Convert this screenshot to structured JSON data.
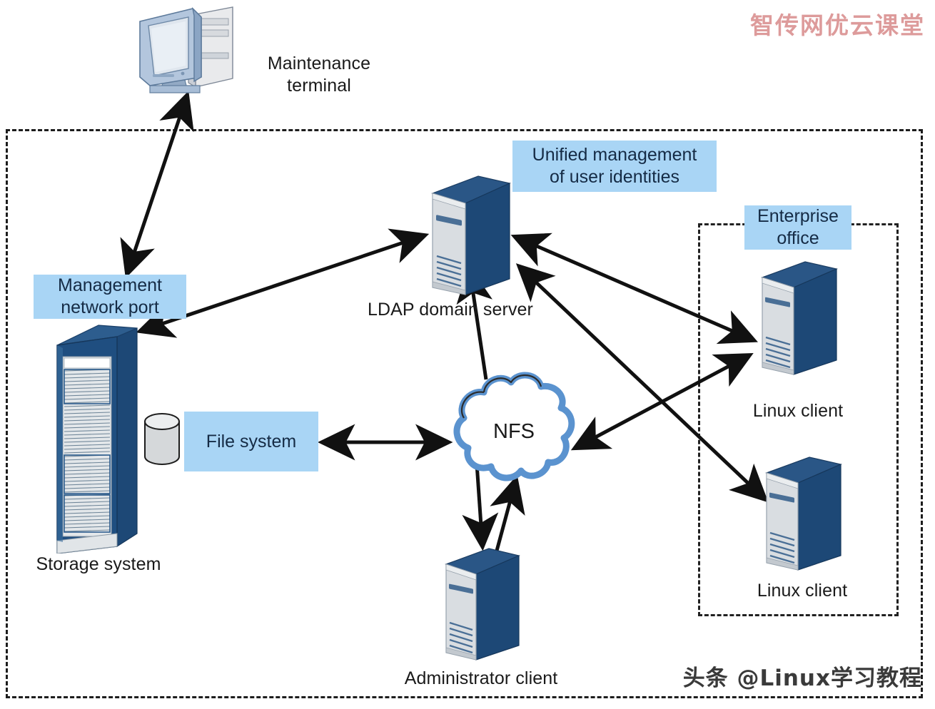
{
  "diagram": {
    "title": "LDAP unified identity with NFS storage architecture",
    "colors": {
      "callout_fill": "#a9d5f5",
      "callout_text": "#152b45",
      "label_text": "#1a1a1a",
      "arrow": "#111111",
      "dashed_border": "#1d1d1d",
      "server_dark": "#1f4a77",
      "server_light": "#dfe4e8",
      "cloud_outline": "#5b93cf",
      "watermark_top": "#d98e8e",
      "watermark_bottom": "#3a3a3a"
    }
  },
  "watermarks": {
    "top_right": "智传网优云课堂",
    "bottom_right": "头条 @Linux学习教程"
  },
  "callouts": [
    {
      "id": "unified-management",
      "text": "Unified management\nof user identities"
    },
    {
      "id": "management-network-port",
      "text": "Management\nnetwork port"
    },
    {
      "id": "enterprise-office",
      "text": "Enterprise\noffice"
    },
    {
      "id": "file-system",
      "text": "File system"
    }
  ],
  "nodes": [
    {
      "id": "maintenance-terminal",
      "label": "Maintenance\nterminal",
      "icon": "crt-workstation-icon"
    },
    {
      "id": "storage-system",
      "label": "Storage system",
      "icon": "storage-rack-icon"
    },
    {
      "id": "disk",
      "label": "",
      "icon": "database-cylinder-icon"
    },
    {
      "id": "ldap-domain-server",
      "label": "LDAP domain server",
      "icon": "server-tower-icon"
    },
    {
      "id": "nfs-cloud",
      "label": "NFS",
      "icon": "cloud-icon"
    },
    {
      "id": "administrator-client",
      "label": "Administrator client",
      "icon": "server-tower-icon"
    },
    {
      "id": "linux-client-1",
      "label": "Linux client",
      "icon": "server-tower-icon"
    },
    {
      "id": "linux-client-2",
      "label": "Linux client",
      "icon": "server-tower-icon"
    }
  ],
  "containers": [
    {
      "id": "datacenter-boundary",
      "style": "dashed"
    },
    {
      "id": "enterprise-office-boundary",
      "style": "dashed"
    }
  ],
  "connections": [
    {
      "id": "terminal-to-management-port",
      "from": "maintenance-terminal",
      "to": "management-network-port",
      "arrow": "double"
    },
    {
      "id": "storage-to-ldap",
      "from": "storage-system",
      "to": "ldap-domain-server",
      "arrow": "double"
    },
    {
      "id": "filesystem-to-nfs",
      "from": "file-system",
      "to": "nfs-cloud",
      "arrow": "double"
    },
    {
      "id": "nfs-to-ldap",
      "from": "nfs-cloud",
      "to": "ldap-domain-server",
      "arrow": "single"
    },
    {
      "id": "nfs-to-admin-down",
      "from": "nfs-cloud",
      "to": "administrator-client",
      "arrow": "single"
    },
    {
      "id": "admin-to-nfs-up",
      "from": "administrator-client",
      "to": "nfs-cloud",
      "arrow": "single"
    },
    {
      "id": "ldap-to-linux-client-1",
      "from": "ldap-domain-server",
      "to": "linux-client-1",
      "arrow": "double"
    },
    {
      "id": "ldap-to-linux-client-2",
      "from": "ldap-domain-server",
      "to": "linux-client-2",
      "arrow": "double"
    },
    {
      "id": "nfs-to-linux-client-1",
      "from": "nfs-cloud",
      "to": "linux-client-1",
      "arrow": "double"
    }
  ]
}
